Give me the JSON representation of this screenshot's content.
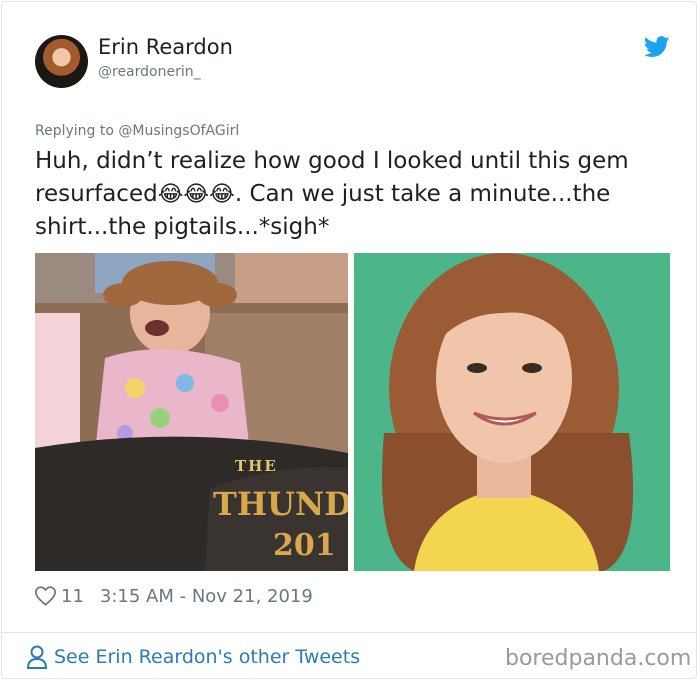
{
  "tweet": {
    "author": {
      "display_name": "Erin Reardon",
      "handle": "@reardonerin_",
      "avatar_icon": "profile-photo"
    },
    "reply_prefix": "Replying to",
    "reply_to": "@MusingsOfAGirl",
    "text_part1": "Huh, didn’t realize how good I looked until this gem resurfaced",
    "emojis": "😂😂😂",
    "text_part2": ". Can we just take a minute...the shirt...the pigtails...*sigh*",
    "images": [
      {
        "overlay_line1": "THE",
        "overlay_line2": "THUNDERH",
        "overlay_line3": "201"
      },
      {}
    ],
    "likes": "11",
    "timestamp": "3:15 AM - Nov 21, 2019"
  },
  "footer": {
    "other_tweets_link": "See Erin Reardon's other Tweets",
    "watermark": "boredpanda.com"
  },
  "colors": {
    "link_blue": "#2b7bb9",
    "twitter_blue": "#1da1f2",
    "muted_gray": "#697882"
  }
}
